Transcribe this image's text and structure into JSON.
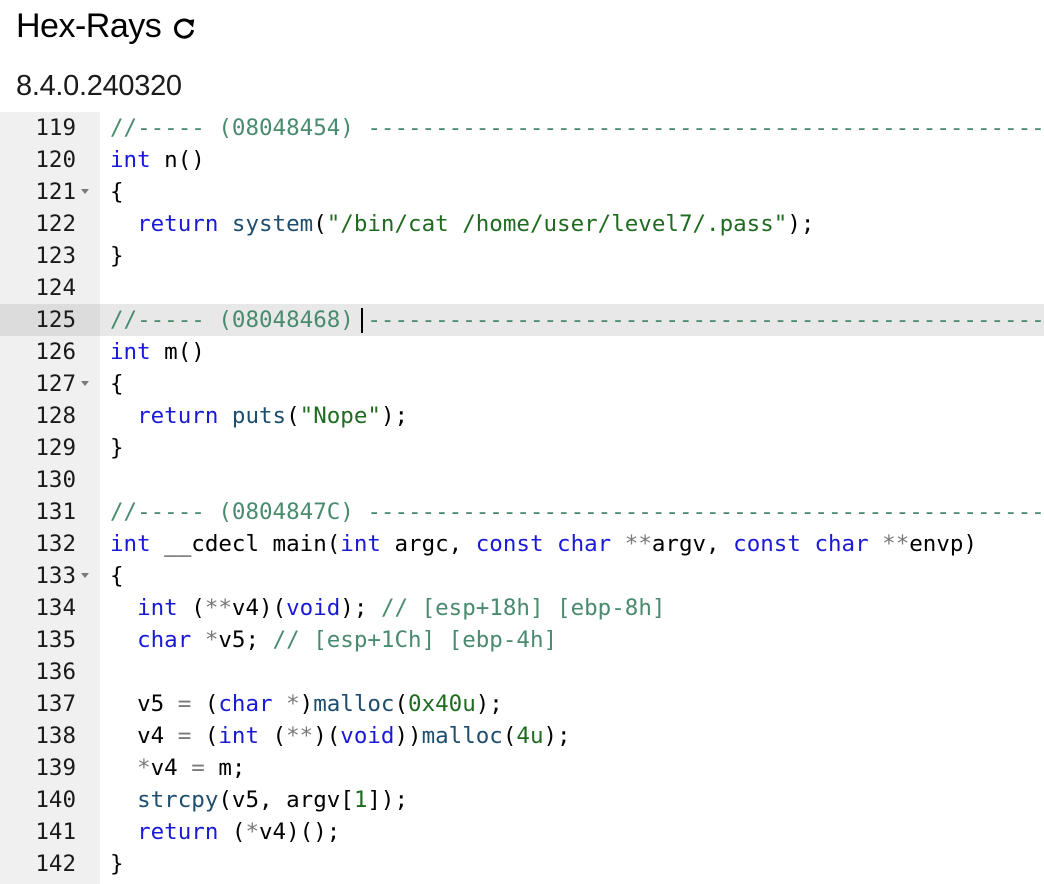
{
  "header": {
    "title": "Hex-Rays",
    "refresh_icon": "refresh-icon",
    "version": "8.4.0.240320"
  },
  "editor": {
    "active_line": "125",
    "lines": [
      {
        "num": "119",
        "fold": false,
        "tokens": [
          {
            "t": "//----- (08048454) -------------------------------------------------------",
            "c": "cm"
          }
        ]
      },
      {
        "num": "120",
        "fold": false,
        "tokens": [
          {
            "t": "int",
            "c": "kw"
          },
          {
            "t": " n",
            "c": "pn"
          },
          {
            "t": "()",
            "c": "pn"
          }
        ]
      },
      {
        "num": "121",
        "fold": true,
        "tokens": [
          {
            "t": "{",
            "c": "pn"
          }
        ]
      },
      {
        "num": "122",
        "fold": false,
        "tokens": [
          {
            "t": "  ",
            "c": "pn"
          },
          {
            "t": "return",
            "c": "kw"
          },
          {
            "t": " ",
            "c": "pn"
          },
          {
            "t": "system",
            "c": "fn"
          },
          {
            "t": "(",
            "c": "pn"
          },
          {
            "t": "\"/bin/cat /home/user/level7/.pass\"",
            "c": "str"
          },
          {
            "t": ");",
            "c": "pn"
          }
        ]
      },
      {
        "num": "123",
        "fold": false,
        "tokens": [
          {
            "t": "}",
            "c": "pn"
          }
        ]
      },
      {
        "num": "124",
        "fold": false,
        "tokens": []
      },
      {
        "num": "125",
        "fold": false,
        "cursor_after": 11,
        "tokens": [
          {
            "t": "//----- (08048468) ",
            "c": "cm"
          },
          {
            "t": "-------------------------------------------------------",
            "c": "cm"
          }
        ]
      },
      {
        "num": "126",
        "fold": false,
        "tokens": [
          {
            "t": "int",
            "c": "kw"
          },
          {
            "t": " m",
            "c": "pn"
          },
          {
            "t": "()",
            "c": "pn"
          }
        ]
      },
      {
        "num": "127",
        "fold": true,
        "tokens": [
          {
            "t": "{",
            "c": "pn"
          }
        ]
      },
      {
        "num": "128",
        "fold": false,
        "tokens": [
          {
            "t": "  ",
            "c": "pn"
          },
          {
            "t": "return",
            "c": "kw"
          },
          {
            "t": " ",
            "c": "pn"
          },
          {
            "t": "puts",
            "c": "fn"
          },
          {
            "t": "(",
            "c": "pn"
          },
          {
            "t": "\"Nope\"",
            "c": "str"
          },
          {
            "t": ");",
            "c": "pn"
          }
        ]
      },
      {
        "num": "129",
        "fold": false,
        "tokens": [
          {
            "t": "}",
            "c": "pn"
          }
        ]
      },
      {
        "num": "130",
        "fold": false,
        "tokens": []
      },
      {
        "num": "131",
        "fold": false,
        "tokens": [
          {
            "t": "//----- (0804847C) -------------------------------------------------------",
            "c": "cm"
          }
        ]
      },
      {
        "num": "132",
        "fold": false,
        "tokens": [
          {
            "t": "int",
            "c": "kw"
          },
          {
            "t": " __cdecl main(",
            "c": "pn"
          },
          {
            "t": "int",
            "c": "kw"
          },
          {
            "t": " argc, ",
            "c": "pn"
          },
          {
            "t": "const",
            "c": "kw"
          },
          {
            "t": " ",
            "c": "pn"
          },
          {
            "t": "char",
            "c": "kw"
          },
          {
            "t": " ",
            "c": "pn"
          },
          {
            "t": "**",
            "c": "op"
          },
          {
            "t": "argv, ",
            "c": "pn"
          },
          {
            "t": "const",
            "c": "kw"
          },
          {
            "t": " ",
            "c": "pn"
          },
          {
            "t": "char",
            "c": "kw"
          },
          {
            "t": " ",
            "c": "pn"
          },
          {
            "t": "**",
            "c": "op"
          },
          {
            "t": "envp)",
            "c": "pn"
          }
        ]
      },
      {
        "num": "133",
        "fold": true,
        "tokens": [
          {
            "t": "{",
            "c": "pn"
          }
        ]
      },
      {
        "num": "134",
        "fold": false,
        "tokens": [
          {
            "t": "  ",
            "c": "pn"
          },
          {
            "t": "int",
            "c": "kw"
          },
          {
            "t": " (",
            "c": "pn"
          },
          {
            "t": "**",
            "c": "op"
          },
          {
            "t": "v4)(",
            "c": "pn"
          },
          {
            "t": "void",
            "c": "kw"
          },
          {
            "t": "); ",
            "c": "pn"
          },
          {
            "t": "// [esp+18h] [ebp-8h]",
            "c": "cm"
          }
        ]
      },
      {
        "num": "135",
        "fold": false,
        "tokens": [
          {
            "t": "  ",
            "c": "pn"
          },
          {
            "t": "char",
            "c": "kw"
          },
          {
            "t": " ",
            "c": "pn"
          },
          {
            "t": "*",
            "c": "op"
          },
          {
            "t": "v5; ",
            "c": "pn"
          },
          {
            "t": "// [esp+1Ch] [ebp-4h]",
            "c": "cm"
          }
        ]
      },
      {
        "num": "136",
        "fold": false,
        "tokens": []
      },
      {
        "num": "137",
        "fold": false,
        "tokens": [
          {
            "t": "  v5 ",
            "c": "pn"
          },
          {
            "t": "=",
            "c": "op"
          },
          {
            "t": " (",
            "c": "pn"
          },
          {
            "t": "char",
            "c": "kw"
          },
          {
            "t": " ",
            "c": "pn"
          },
          {
            "t": "*",
            "c": "op"
          },
          {
            "t": ")",
            "c": "pn"
          },
          {
            "t": "malloc",
            "c": "fn"
          },
          {
            "t": "(",
            "c": "pn"
          },
          {
            "t": "0x40u",
            "c": "num"
          },
          {
            "t": ");",
            "c": "pn"
          }
        ]
      },
      {
        "num": "138",
        "fold": false,
        "tokens": [
          {
            "t": "  v4 ",
            "c": "pn"
          },
          {
            "t": "=",
            "c": "op"
          },
          {
            "t": " (",
            "c": "pn"
          },
          {
            "t": "int",
            "c": "kw"
          },
          {
            "t": " (",
            "c": "pn"
          },
          {
            "t": "**",
            "c": "op"
          },
          {
            "t": ")(",
            "c": "pn"
          },
          {
            "t": "void",
            "c": "kw"
          },
          {
            "t": "))",
            "c": "pn"
          },
          {
            "t": "malloc",
            "c": "fn"
          },
          {
            "t": "(",
            "c": "pn"
          },
          {
            "t": "4u",
            "c": "num"
          },
          {
            "t": ");",
            "c": "pn"
          }
        ]
      },
      {
        "num": "139",
        "fold": false,
        "tokens": [
          {
            "t": "  ",
            "c": "pn"
          },
          {
            "t": "*",
            "c": "op"
          },
          {
            "t": "v4 ",
            "c": "pn"
          },
          {
            "t": "=",
            "c": "op"
          },
          {
            "t": " m;",
            "c": "pn"
          }
        ]
      },
      {
        "num": "140",
        "fold": false,
        "tokens": [
          {
            "t": "  ",
            "c": "pn"
          },
          {
            "t": "strcpy",
            "c": "fn"
          },
          {
            "t": "(v5, argv[",
            "c": "pn"
          },
          {
            "t": "1",
            "c": "num"
          },
          {
            "t": "]);",
            "c": "pn"
          }
        ]
      },
      {
        "num": "141",
        "fold": false,
        "tokens": [
          {
            "t": "  ",
            "c": "pn"
          },
          {
            "t": "return",
            "c": "kw"
          },
          {
            "t": " (",
            "c": "pn"
          },
          {
            "t": "*",
            "c": "op"
          },
          {
            "t": "v4)();",
            "c": "pn"
          }
        ]
      },
      {
        "num": "142",
        "fold": false,
        "tokens": [
          {
            "t": "}",
            "c": "pn"
          }
        ]
      }
    ]
  }
}
